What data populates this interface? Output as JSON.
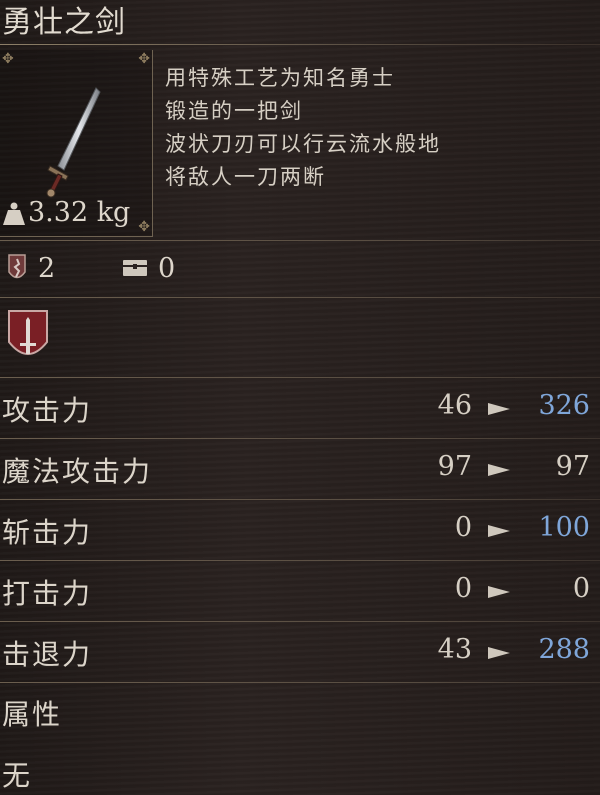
{
  "weapon": {
    "name": "勇壮之剑",
    "description": [
      "用特殊工艺为知名勇士",
      "锻造的一把剑",
      "波状刀刃可以行云流水般地",
      "将敌人一刀两断"
    ],
    "weight": "3.32 kg",
    "icon": "wavy-sword-icon"
  },
  "requirements": {
    "strength": "2",
    "strength_icon": "strength-crest-icon",
    "storage": "0",
    "storage_icon": "storage-chest-icon"
  },
  "category_icon": "sword-shield-icon",
  "stats": [
    {
      "label": "攻击力",
      "base": "46",
      "new": "326",
      "new_color": "#7fa6d9"
    },
    {
      "label": "魔法攻击力",
      "base": "97",
      "new": "97",
      "new_color": "#d6cfc4"
    },
    {
      "label": "斩击力",
      "base": "0",
      "new": "100",
      "new_color": "#7fa6d9"
    },
    {
      "label": "打击力",
      "base": "0",
      "new": "0",
      "new_color": "#d6cfc4"
    },
    {
      "label": "击退力",
      "base": "43",
      "new": "288",
      "new_color": "#7fa6d9"
    }
  ],
  "element": {
    "label": "属性",
    "value": "无"
  }
}
